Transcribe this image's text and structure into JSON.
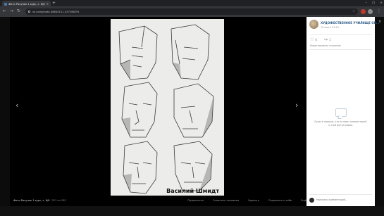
{
  "browser": {
    "tab_title": "Фото Рисунок 1 курс, с. 6/6",
    "tab_close": "×",
    "new_tab": "+",
    "url": "vk.com/photo-36844131_457268291",
    "window_min": "–",
    "window_max": "□",
    "window_close": "×",
    "back": "←",
    "forward": "→",
    "reload": "↻",
    "star": "☆",
    "menu": "⋮"
  },
  "viewer": {
    "signature": "Василий Шмидт",
    "prev_arrow": "‹",
    "next_arrow": "›",
    "album_info": "Фото Рисунок 1 курс, с. 6/6",
    "dimensions": "221 из 282",
    "actions": [
      "Поделиться",
      "Отметить человека",
      "Удалить",
      "Сохранить к себе",
      "Ещё"
    ]
  },
  "panel": {
    "author_name": "ХУДОЖЕСТВЕННОЕ УЧИЛИЩЕ ОН...",
    "author_date": "15 мая в 23:19",
    "likes": "6",
    "shares": "1",
    "edit_label": "Редактировать описание",
    "empty_text": "Будьте первым, кто оставит комментарий к этой фотографии.",
    "comment_placeholder": "Написать комментарий..."
  },
  "close_label": "×",
  "colors": {
    "link": "#2a5885",
    "vk_blue": "#4a76a8"
  }
}
